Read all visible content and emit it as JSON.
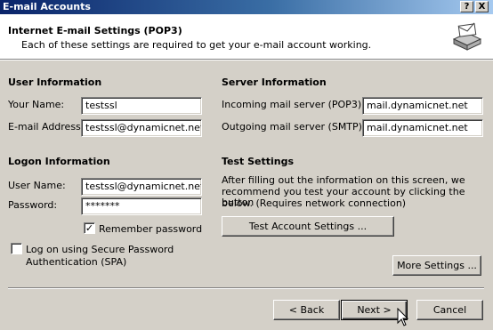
{
  "window": {
    "title": "E-mail Accounts",
    "help_label": "?",
    "close_label": "X"
  },
  "header": {
    "title": "Internet E-mail Settings (POP3)",
    "subtitle": "Each of these settings are required to get your e-mail account working."
  },
  "user_info": {
    "heading": "User Information",
    "name_label": "Your Name:",
    "name_value": "testssl",
    "email_label": "E-mail Address:",
    "email_value": "testssl@dynamicnet.net"
  },
  "server_info": {
    "heading": "Server Information",
    "incoming_label": "Incoming mail server (POP3):",
    "incoming_value": "mail.dynamicnet.net",
    "outgoing_label": "Outgoing mail server (SMTP):",
    "outgoing_value": "mail.dynamicnet.net"
  },
  "logon_info": {
    "heading": "Logon Information",
    "username_label": "User Name:",
    "username_value": "testssl@dynamicnet.net",
    "password_label": "Password:",
    "password_value": "*******",
    "remember_label": "Remember password",
    "remember_checked": true,
    "remember_mark": "✓",
    "spa_label_line1": "Log on using Secure Password",
    "spa_label_line2": "Authentication (SPA)",
    "spa_checked": false
  },
  "test_settings": {
    "heading": "Test Settings",
    "desc_line1": "After filling out the information on this screen, we",
    "desc_line2": "recommend you test your account by clicking the button",
    "desc_line3": "below. (Requires network connection)",
    "test_button": "Test Account Settings ..."
  },
  "more_settings_button": "More Settings ...",
  "nav": {
    "back": "< Back",
    "next": "Next >",
    "cancel": "Cancel"
  }
}
